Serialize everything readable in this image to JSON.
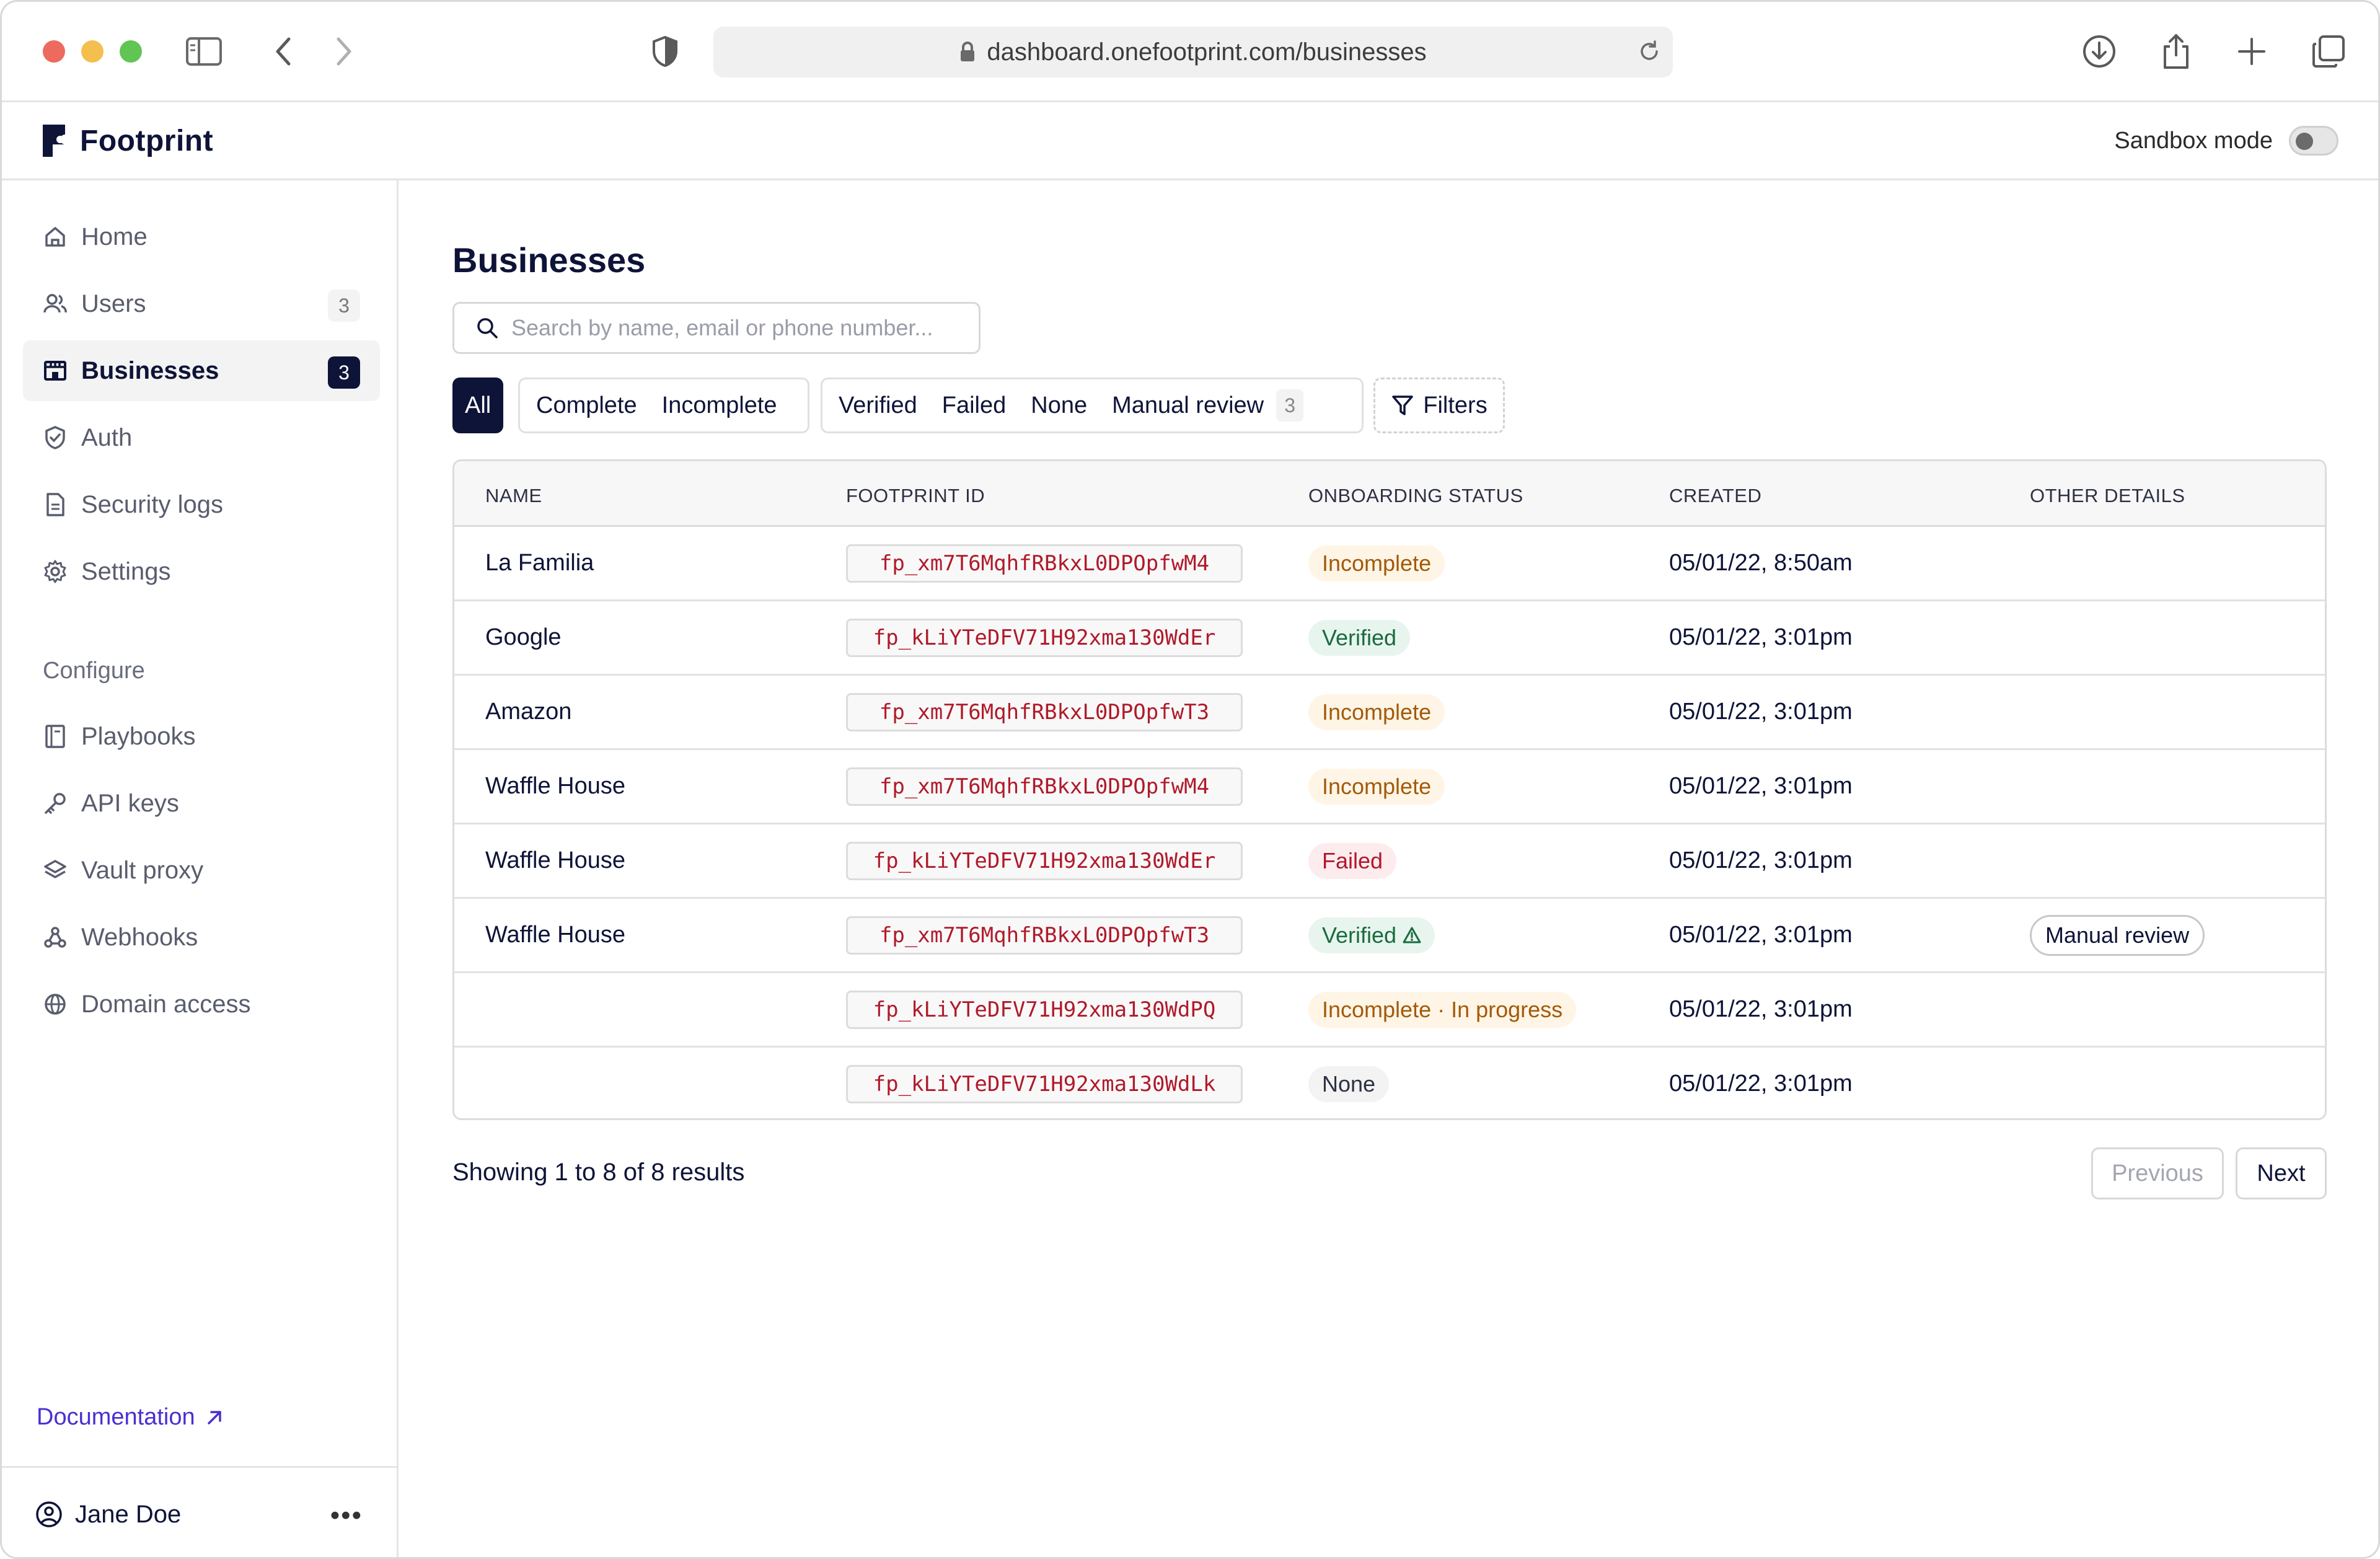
{
  "browser": {
    "url": "dashboard.onefootprint.com/businesses"
  },
  "app": {
    "brand": "Footprint",
    "sandbox_label": "Sandbox mode"
  },
  "sidebar": {
    "items": [
      {
        "label": "Home",
        "icon": "home-icon"
      },
      {
        "label": "Users",
        "icon": "users-icon",
        "badge": "3"
      },
      {
        "label": "Businesses",
        "icon": "store-icon",
        "badge": "3",
        "active": true
      },
      {
        "label": "Auth",
        "icon": "shield-check-icon"
      },
      {
        "label": "Security logs",
        "icon": "file-icon"
      },
      {
        "label": "Settings",
        "icon": "gear-icon"
      }
    ],
    "section_label": "Configure",
    "config_items": [
      {
        "label": "Playbooks",
        "icon": "book-icon"
      },
      {
        "label": "API keys",
        "icon": "key-icon"
      },
      {
        "label": "Vault proxy",
        "icon": "layers-icon"
      },
      {
        "label": "Webhooks",
        "icon": "webhook-icon"
      },
      {
        "label": "Domain access",
        "icon": "globe-icon"
      }
    ],
    "documentation": "Documentation",
    "user_name": "Jane Doe"
  },
  "main": {
    "title": "Businesses",
    "search_placeholder": "Search by name, email or phone number...",
    "filters": {
      "all": "All",
      "complete": "Complete",
      "incomplete": "Incomplete",
      "verified": "Verified",
      "failed": "Failed",
      "none": "None",
      "manual_review": "Manual review",
      "manual_review_count": "3",
      "filters_button": "Filters"
    },
    "table": {
      "columns": [
        "NAME",
        "FOOTPRINT ID",
        "ONBOARDING STATUS",
        "CREATED",
        "OTHER DETAILS"
      ],
      "rows": [
        {
          "name": "La Familia",
          "fp_id": "fp_xm7T6MqhfRBkxL0DPOpfwM4",
          "status": "Incomplete",
          "status_kind": "incomplete",
          "created": "05/01/22, 8:50am",
          "other": ""
        },
        {
          "name": "Google",
          "fp_id": "fp_kLiYTeDFV71H92xma130WdEr",
          "status": "Verified",
          "status_kind": "verified",
          "created": "05/01/22, 3:01pm",
          "other": ""
        },
        {
          "name": "Amazon",
          "fp_id": "fp_xm7T6MqhfRBkxL0DPOpfwT3",
          "status": "Incomplete",
          "status_kind": "incomplete",
          "created": "05/01/22, 3:01pm",
          "other": ""
        },
        {
          "name": "Waffle House",
          "fp_id": "fp_xm7T6MqhfRBkxL0DPOpfwM4",
          "status": "Incomplete",
          "status_kind": "incomplete",
          "created": "05/01/22, 3:01pm",
          "other": ""
        },
        {
          "name": "Waffle House",
          "fp_id": "fp_kLiYTeDFV71H92xma130WdEr",
          "status": "Failed",
          "status_kind": "failed",
          "created": "05/01/22, 3:01pm",
          "other": ""
        },
        {
          "name": "Waffle House",
          "fp_id": "fp_xm7T6MqhfRBkxL0DPOpfwT3",
          "status": "Verified",
          "status_kind": "verified",
          "status_icon": "warning-icon",
          "created": "05/01/22, 3:01pm",
          "other": "Manual review"
        },
        {
          "name": "",
          "fp_id": "fp_kLiYTeDFV71H92xma130WdPQ",
          "status": "Incomplete · In progress",
          "status_kind": "incomplete",
          "created": "05/01/22, 3:01pm",
          "other": ""
        },
        {
          "name": "",
          "fp_id": "fp_kLiYTeDFV71H92xma130WdLk",
          "status": "None",
          "status_kind": "none",
          "created": "05/01/22, 3:01pm",
          "other": ""
        }
      ]
    },
    "results_text": "Showing 1 to 8 of 8 results",
    "pager": {
      "previous": "Previous",
      "next": "Next"
    }
  }
}
